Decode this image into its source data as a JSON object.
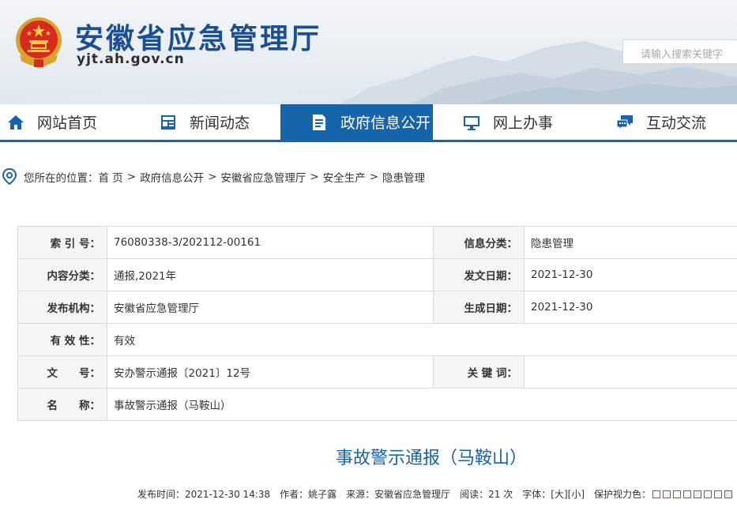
{
  "header": {
    "title": "安徽省应急管理厅",
    "domain": "yjt.ah.gov.cn",
    "search_placeholder": "请输入搜索关键字"
  },
  "nav": {
    "items": [
      {
        "label": "网站首页",
        "icon": "home-icon"
      },
      {
        "label": "新闻动态",
        "icon": "news-icon"
      },
      {
        "label": "政府信息公开",
        "icon": "document-icon",
        "active": true
      },
      {
        "label": "网上办事",
        "icon": "monitor-icon"
      },
      {
        "label": "互动交流",
        "icon": "chat-icon"
      }
    ]
  },
  "breadcrumb": {
    "prefix": "您所在的位置：",
    "items": [
      "首 页",
      "政府信息公开",
      "安徽省应急管理厅",
      "安全生产",
      "隐患管理"
    ],
    "separator": ">"
  },
  "info": {
    "index_label": "索 引 号：",
    "index_value": "76080338-3/202112-00161",
    "category_label": "信息分类：",
    "category_value": "隐患管理",
    "content_label": "内容分类：",
    "content_value": "通报,2021年",
    "issue_date_label": "发文日期：",
    "issue_date_value": "2021-12-30",
    "publisher_label": "发布机构：",
    "publisher_value": "安徽省应急管理厅",
    "gen_date_label": "生成日期：",
    "gen_date_value": "2021-12-30",
    "validity_label": "有 效 性：",
    "validity_value": "有效",
    "doc_no_label": "文　　号：",
    "doc_no_value": "安办警示通报〔2021〕12号",
    "keywords_label": "关 键 词：",
    "keywords_value": "",
    "name_label": "名　　称：",
    "name_value": "事故警示通报（马鞍山）"
  },
  "article": {
    "title": "事故警示通报（马鞍山）",
    "publish_time": "发布时间：2021-12-30 14:38",
    "author": "作者：姚子露",
    "source": "来源：安徽省应急管理厅",
    "reads": "阅读：21 次",
    "font_label": "字体：",
    "font_large": "[大]",
    "font_small": "[小]",
    "vision_label": "保护视力色："
  },
  "colors": {
    "brand": "#1664a9",
    "vision_swatches": [
      "#ffffff",
      "#faf0e6",
      "#fffff0",
      "#f0fff0",
      "#e6f2e6",
      "#f0f8ff",
      "#f5f5f5",
      "#e8e8e8"
    ]
  }
}
